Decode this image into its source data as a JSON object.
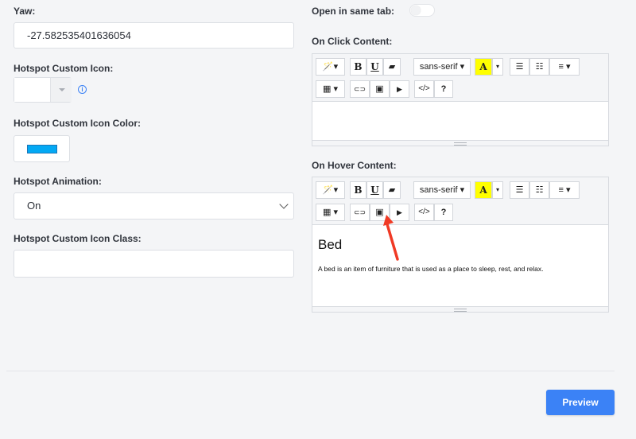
{
  "left": {
    "yaw_label": "Yaw:",
    "yaw_value": "-27.582535401636054",
    "icon_label": "Hotspot Custom Icon:",
    "icon_info": "i",
    "icon_color_label": "Hotspot Custom Icon Color:",
    "icon_color_value": "#03a9f4",
    "animation_label": "Hotspot Animation:",
    "animation_value": "On",
    "icon_class_label": "Hotspot Custom Icon Class:",
    "icon_class_value": ""
  },
  "right": {
    "same_tab_label": "Open in same tab:",
    "same_tab_on": false,
    "click_label": "On Click Content:",
    "hover_label": "On Hover Content:",
    "hover_heading": "Bed",
    "hover_text": "A bed is an item of furniture that is used as a place to sleep, rest, and relax."
  },
  "toolbar": {
    "magic": "🪄▾",
    "bold": "B",
    "underline": "U",
    "eraser": "▰",
    "font": "sans-serif ▾",
    "color_a": "A",
    "color_caret": "▾",
    "ul": "☰",
    "ol": "☷",
    "align": "≡ ▾",
    "table": "▦ ▾",
    "link": "⊂⊃",
    "image": "▣",
    "video": "▶",
    "code": "</>",
    "help": "?"
  },
  "actions": {
    "preview": "Preview"
  },
  "colors": {
    "accent": "#3b82f6",
    "swatch": "#03a9f4",
    "highlight": "#ffff00",
    "annotation_arrow": "#f03a25"
  }
}
